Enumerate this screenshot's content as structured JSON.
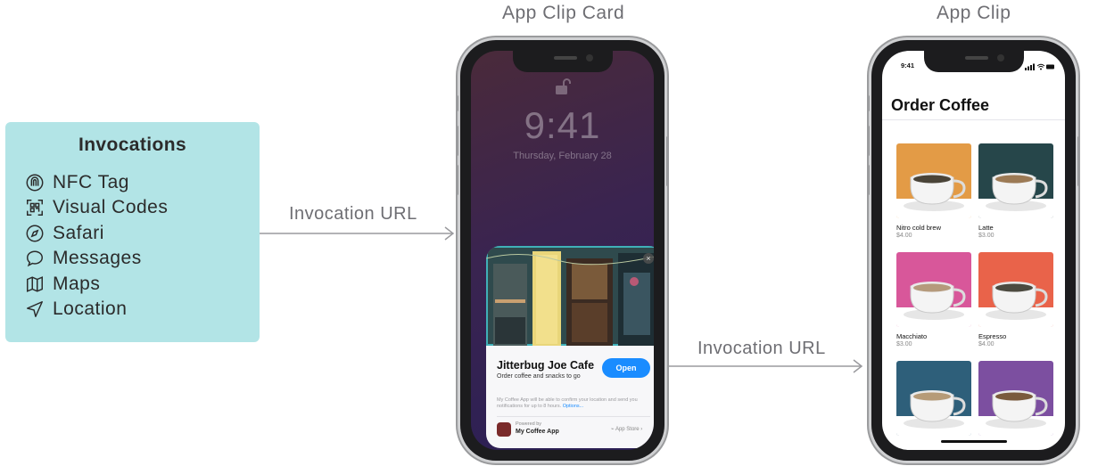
{
  "titles": {
    "card_phone": "App Clip Card",
    "clip_phone": "App Clip"
  },
  "invocations": {
    "title": "Invocations",
    "items": [
      {
        "label": "NFC Tag",
        "icon": "nfc-icon"
      },
      {
        "label": "Visual Codes",
        "icon": "qr-code-icon"
      },
      {
        "label": "Safari",
        "icon": "compass-icon"
      },
      {
        "label": "Messages",
        "icon": "message-bubble-icon"
      },
      {
        "label": "Maps",
        "icon": "map-icon"
      },
      {
        "label": "Location",
        "icon": "location-arrow-icon"
      }
    ]
  },
  "arrows": {
    "first_label": "Invocation URL",
    "second_label": "Invocation URL"
  },
  "lock_screen": {
    "time": "9:41",
    "date": "Thursday, February 28"
  },
  "card": {
    "title": "Jitterbug Joe Cafe",
    "subtitle": "Order coffee and snacks to go",
    "open_label": "Open",
    "notice": "My Coffee App will be able to confirm your location and send you notifications for up to 8 hours.",
    "options_link": "Options...",
    "powered_by": "Powered by",
    "app_name": "My Coffee App",
    "app_store": "App Store"
  },
  "clip": {
    "status_time": "9:41",
    "title": "Order Coffee",
    "products": [
      {
        "name": "Nitro cold brew",
        "price": "$4.00",
        "color": "#e39b46",
        "coffee": "#4a4438"
      },
      {
        "name": "Latte",
        "price": "$3.00",
        "color": "#26464a",
        "coffee": "#9c7a55"
      },
      {
        "name": "Macchiato",
        "price": "$3.00",
        "color": "#d8579a",
        "coffee": "#b59a7c"
      },
      {
        "name": "Espresso",
        "price": "$4.00",
        "color": "#e9634a",
        "coffee": "#4c4a40"
      },
      {
        "name": "",
        "price": "",
        "color": "#2e5f7a",
        "coffee": "#b69b78"
      },
      {
        "name": "",
        "price": "",
        "color": "#7c4fa0",
        "coffee": "#7a5a3c"
      }
    ]
  }
}
